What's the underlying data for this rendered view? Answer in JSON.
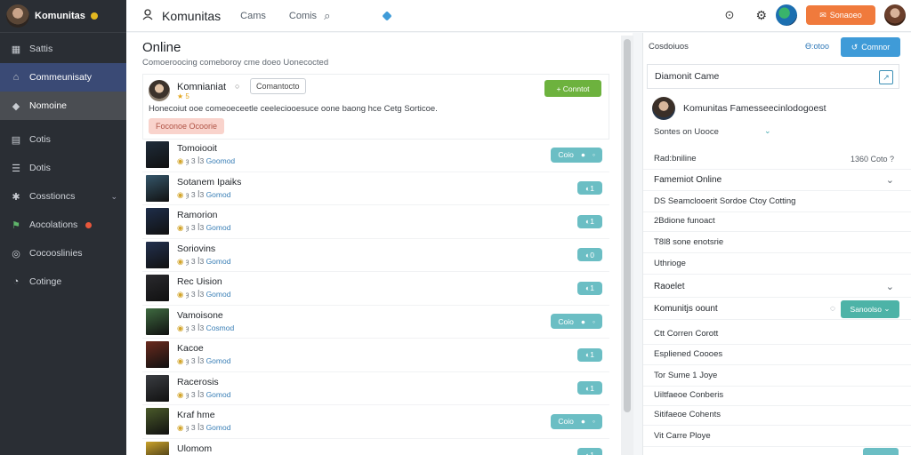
{
  "sidebar": {
    "title": "Komunitas",
    "items": [
      {
        "label": "Sattis",
        "icon": "grid-icon",
        "glyph": "▦"
      },
      {
        "label": "Commeunisaty",
        "icon": "home-icon",
        "glyph": "⌂"
      },
      {
        "label": "Nomoine",
        "icon": "tag-icon",
        "glyph": "◆"
      },
      {
        "label": "Cotis",
        "icon": "list-icon",
        "glyph": "▤"
      },
      {
        "label": "Dotis",
        "icon": "menu-icon",
        "glyph": "☰"
      },
      {
        "label": "Cosstioncs",
        "icon": "settings-icon",
        "glyph": "✱"
      },
      {
        "label": "Aocolations",
        "icon": "flag-icon",
        "glyph": "⚑"
      },
      {
        "label": "Cocooslinies",
        "icon": "globe-icon",
        "glyph": "◎"
      },
      {
        "label": "Cotinge",
        "icon": "clock-icon",
        "glyph": "◔"
      }
    ]
  },
  "topbar": {
    "brand": "Komunitas",
    "link1": "Cams",
    "link2": "Comis",
    "search_glyph": "⌕",
    "help_glyph": "⊙",
    "gear_glyph": "⚙",
    "action_label": "Sonaoeo"
  },
  "main": {
    "title": "Online",
    "subtitle": "Comoeroocing comeboroy cme doeo Uonecocted",
    "card": {
      "name": "Komnianiat",
      "tag": "Comantocto",
      "meta": "★ 5",
      "text": "Honecoiut ooe comeoeceetle ceeleciooesuce oone baong hce Cetg Sorticoe.",
      "pill": "Foconoe Ocoorie",
      "button": "+ Conntot"
    },
    "rows": [
      {
        "name": "Tomoiooit",
        "meta": "ȝ 3 ꟾ3",
        "extra": "Goomod",
        "action": "Coio",
        "thumb": "#1f2c3a",
        "wide": true
      },
      {
        "name": "Sotanem Ipaiks",
        "meta": "ȝ 3 ꟾ3",
        "extra": "Gomod",
        "action": "1",
        "thumb": "#35566a",
        "wide": false
      },
      {
        "name": "Ramorion",
        "meta": "ȝ 3 ꟾ3",
        "extra": "Gomod",
        "action": "1",
        "thumb": "#1e2e4a",
        "wide": false
      },
      {
        "name": "Soriovins",
        "meta": "ȝ 3 ꟾ3",
        "extra": "Gomod",
        "action": "0",
        "thumb": "#23314f",
        "wide": false
      },
      {
        "name": "Rec Uision",
        "meta": "ȝ 3 ꟾ3",
        "extra": "Gomod",
        "action": "1",
        "thumb": "#2a2a2e",
        "wide": false
      },
      {
        "name": "Vamoisone",
        "meta": "ȝ 3 ꟾ3",
        "extra": "Cosmod",
        "action": "Coio",
        "thumb": "#3e6a40",
        "wide": true
      },
      {
        "name": "Kacoe",
        "meta": "ȝ 3 ꟾ3",
        "extra": "Gomod",
        "action": "1",
        "thumb": "#6a2a1e",
        "wide": false
      },
      {
        "name": "Racerosis",
        "meta": "ȝ 3 ꟾ3",
        "extra": "Gomod",
        "action": "1",
        "thumb": "#3a3d42",
        "wide": false
      },
      {
        "name": "Kraf hme",
        "meta": "ȝ 3 ꟾ3",
        "extra": "Gomod",
        "action": "Coio",
        "thumb": "#4a5a2a",
        "wide": true
      },
      {
        "name": "Ulomom",
        "meta": "ȝ 3 ꟾ3",
        "extra": "Gomod",
        "action": "1",
        "thumb": "#c9a22a",
        "wide": false
      }
    ]
  },
  "right_panel": {
    "heading": "Cosdoiuos",
    "count": "Ɵ:otoo",
    "button": "Comnor",
    "box_label": "Diamonit Came",
    "user": "Komunitas Famesseecinlodogoest",
    "sub": "Sontes on Uooce",
    "rows": [
      {
        "label": "Rad:bniline",
        "meta": "1360 Coto ?",
        "section": false
      },
      {
        "label": "Famemiot Online",
        "chevron": true,
        "section": true
      },
      {
        "label": "DS Seamclooerit Sordoe Ctoy Cotting",
        "section": false
      },
      {
        "label": "2Bdione funoact",
        "section": false
      },
      {
        "label": "T8l8 sone enotsrie",
        "section": false
      },
      {
        "label": "Uthrioge",
        "section": false
      },
      {
        "label": "Raoelet",
        "chevron": true,
        "section": true
      },
      {
        "label": "Komunitjs oount",
        "select": "Sanoolso",
        "section": true
      },
      {
        "label": "Ctt Corren Corott",
        "section": false
      },
      {
        "label": "Espliened Coooes",
        "section": false
      },
      {
        "label": "Tor Sume 1 Joye",
        "section": false
      },
      {
        "label": "Uiltfaeoe Conberis",
        "section": false
      },
      {
        "label": "Sitifaeoe Cohents",
        "section": false
      },
      {
        "label": "Vit Carre Ploye",
        "section": false
      }
    ]
  }
}
